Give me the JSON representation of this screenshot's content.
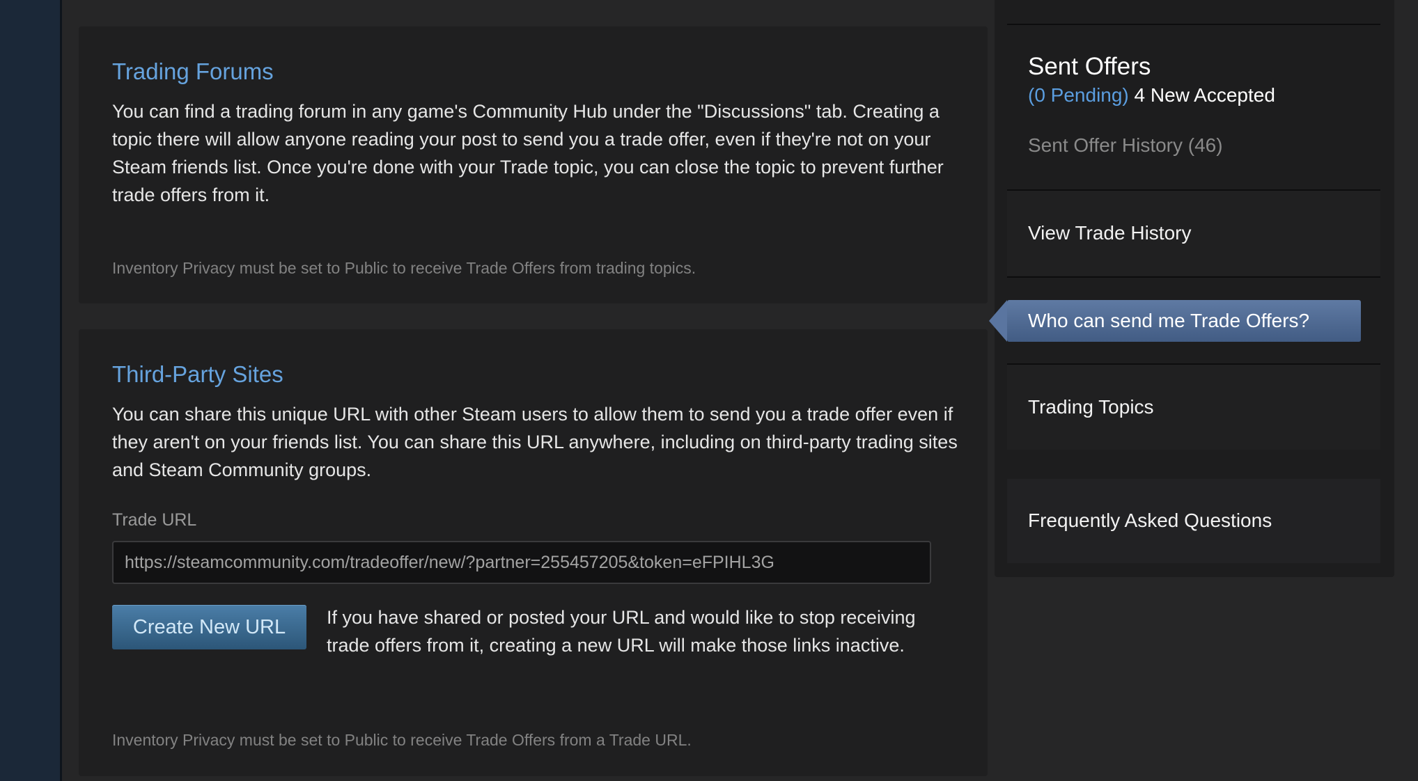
{
  "forums": {
    "title": "Trading Forums",
    "body": "You can find a trading forum in any game's Community Hub under the \"Discussions\" tab. Creating a topic there will allow anyone reading your post to send you a trade offer, even if they're not on your Steam friends list. Once you're done with your Trade topic, you can close the topic to prevent further trade offers from it.",
    "note": "Inventory Privacy must be set to Public to receive Trade Offers from trading topics."
  },
  "third_party": {
    "title": "Third-Party Sites",
    "body": "You can share this unique URL with other Steam users to allow them to send you a trade offer even if they aren't on your friends list. You can share this URL anywhere, including on third-party trading sites and Steam Community groups.",
    "trade_url_label": "Trade URL",
    "trade_url_value": "https://steamcommunity.com/tradeoffer/new/?partner=255457205&token=eFPIHL3G",
    "create_button": "Create New URL",
    "create_note": "If you have shared or posted your URL and would like to stop receiving trade offers from it, creating a new URL will make those links inactive.",
    "note": "Inventory Privacy must be set to Public to receive Trade Offers from a Trade URL."
  },
  "sidebar": {
    "sent_offers_title": "Sent Offers",
    "pending": "(0 Pending)",
    "new_accepted": "4 New Accepted",
    "sent_history": "Sent Offer History (46)",
    "view_trade_history": "View Trade History",
    "who_can_send": "Who can send me Trade Offers?",
    "trading_topics": "Trading Topics",
    "faq": "Frequently Asked Questions"
  },
  "colors": {
    "accent_link": "#66a3de",
    "active_item": "#5f7aa3",
    "button": "#4b7ea8"
  }
}
